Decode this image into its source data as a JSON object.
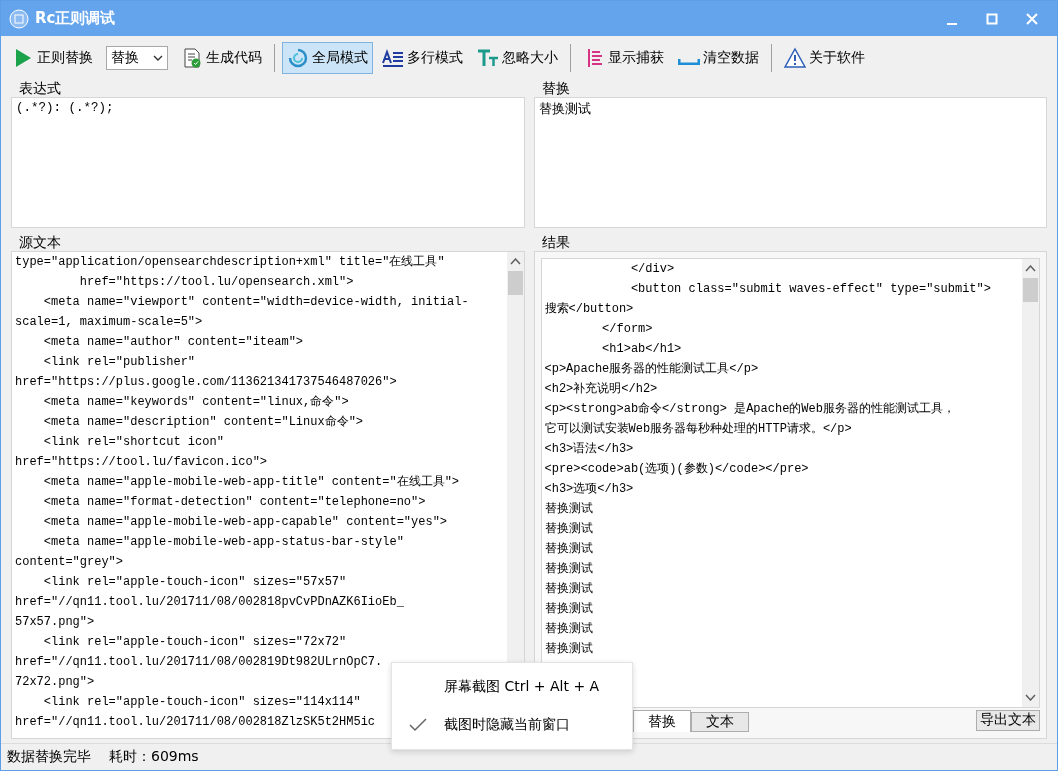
{
  "window": {
    "title": "Rc正则调试"
  },
  "toolbar": [
    {
      "kind": "run",
      "label": "正则替换"
    },
    {
      "kind": "select",
      "value": "替换"
    },
    {
      "kind": "code",
      "label": "生成代码",
      "pressed": false
    },
    {
      "kind": "separator"
    },
    {
      "kind": "global",
      "label": "全局模式",
      "pressed": true
    },
    {
      "kind": "multiline",
      "label": "多行模式",
      "pressed": false
    },
    {
      "kind": "ignorecase",
      "label": "忽略大小",
      "pressed": false
    },
    {
      "kind": "separator"
    },
    {
      "kind": "captures",
      "label": "显示捕获",
      "pressed": false
    },
    {
      "kind": "clear",
      "label": "清空数据",
      "pressed": false
    },
    {
      "kind": "separator"
    },
    {
      "kind": "about",
      "label": "关于软件",
      "pressed": false
    }
  ],
  "expression": {
    "label": "表达式",
    "value": "(.*?): (.*?);"
  },
  "replacement": {
    "label": "替换",
    "value": "替换测试"
  },
  "source": {
    "label": "源文本",
    "lines": [
      "type=\"application/opensearchdescription+xml\" title=\"在线工具\"",
      "         href=\"https://tool.lu/opensearch.xml\">",
      "    <meta name=\"viewport\" content=\"width=device-width, initial-",
      "scale=1, maximum-scale=5\">",
      "    <meta name=\"author\" content=\"iteam\">",
      "    <link rel=\"publisher\"",
      "href=\"https://plus.google.com/113621341737546487026\">",
      "    <meta name=\"keywords\" content=\"linux,命令\">",
      "    <meta name=\"description\" content=\"Linux命令\">",
      "    <link rel=\"shortcut icon\"",
      "href=\"https://tool.lu/favicon.ico\">",
      "    <meta name=\"apple-mobile-web-app-title\" content=\"在线工具\">",
      "    <meta name=\"format-detection\" content=\"telephone=no\">",
      "    <meta name=\"apple-mobile-web-app-capable\" content=\"yes\">",
      "    <meta name=\"apple-mobile-web-app-status-bar-style\"",
      "content=\"grey\">",
      "    <link rel=\"apple-touch-icon\" sizes=\"57x57\"",
      "href=\"//qn11.tool.lu/201711/08/002818pvCvPDnAZK6IioEb_",
      "57x57.png\">",
      "    <link rel=\"apple-touch-icon\" sizes=\"72x72\"",
      "href=\"//qn11.tool.lu/201711/08/002819Dt982ULrnOpC7.",
      "72x72.png\">",
      "    <link rel=\"apple-touch-icon\" sizes=\"114x114\"",
      "href=\"//qn11.tool.lu/201711/08/002818ZlzSK5t2HM5ic"
    ]
  },
  "result": {
    "label": "结果",
    "lines": [
      "            </div>",
      "            <button class=\"submit waves-effect\" type=\"submit\">",
      "搜索</button>",
      "        </form>",
      "        <h1>ab</h1>",
      "<p>Apache服务器的性能测试工具</p>",
      "<h2>补充说明</h2>",
      "<p><strong>ab命令</strong> 是Apache的Web服务器的性能测试工具，",
      "它可以测试安装Web服务器每秒种处理的HTTP请求。</p>",
      "<h3>语法</h3>",
      "<pre><code>ab(选项)(参数)</code></pre>",
      "<h3>选项</h3>",
      "替换测试",
      "替换测试",
      "替换测试",
      "替换测试",
      "替换测试",
      "替换测试",
      "替换测试",
      "替换测试"
    ],
    "tabs": [
      {
        "label": "替换",
        "selected": true
      },
      {
        "label": "文本",
        "selected": false
      }
    ],
    "export_button": "导出文本"
  },
  "status_bar": {
    "message": "数据替换完毕",
    "elapsed": "耗时：609ms"
  },
  "context_menu": [
    {
      "label": "屏幕截图 Ctrl + Alt + A",
      "checked": false
    },
    {
      "label": "截图时隐藏当前窗口",
      "checked": true
    }
  ]
}
